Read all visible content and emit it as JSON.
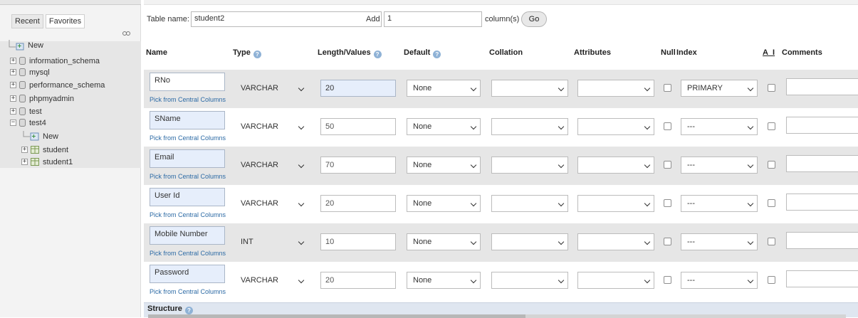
{
  "sidebar": {
    "tabs": [
      "Recent",
      "Favorites"
    ],
    "tree": [
      {
        "label": "New",
        "kind": "new"
      },
      {
        "label": "information_schema",
        "kind": "db"
      },
      {
        "label": "mysql",
        "kind": "db"
      },
      {
        "label": "performance_schema",
        "kind": "db"
      },
      {
        "label": "phpmyadmin",
        "kind": "db"
      },
      {
        "label": "test",
        "kind": "db"
      },
      {
        "label": "test4",
        "kind": "db-open"
      },
      {
        "label": "New",
        "kind": "new-child"
      },
      {
        "label": "student",
        "kind": "table"
      },
      {
        "label": "student1",
        "kind": "table"
      }
    ]
  },
  "form": {
    "table_name_label": "Table name:",
    "table_name_value": "student2",
    "add_label": "Add",
    "add_value": "1",
    "columns_label": "column(s)",
    "go_label": "Go"
  },
  "headers": {
    "name": "Name",
    "type": "Type",
    "length": "Length/Values",
    "default": "Default",
    "collation": "Collation",
    "attributes": "Attributes",
    "null": "Null",
    "index": "Index",
    "ai": "A_I",
    "comments": "Comments"
  },
  "pick_label": "Pick from Central Columns",
  "rows": [
    {
      "name": "RNo",
      "type": "VARCHAR",
      "length": "20",
      "default": "None",
      "index": "PRIMARY"
    },
    {
      "name": "SName",
      "type": "VARCHAR",
      "length": "50",
      "default": "None",
      "index": "---"
    },
    {
      "name": "Email",
      "type": "VARCHAR",
      "length": "70",
      "default": "None",
      "index": "---"
    },
    {
      "name": "User Id",
      "type": "VARCHAR",
      "length": "20",
      "default": "None",
      "index": "---"
    },
    {
      "name": "Mobile Number",
      "type": "INT",
      "length": "10",
      "default": "None",
      "index": "---"
    },
    {
      "name": "Password",
      "type": "VARCHAR",
      "length": "20",
      "default": "None",
      "index": "---"
    }
  ],
  "footer": {
    "structure_label": "Structure"
  },
  "colors": {
    "row_shade": "#e6e6e6",
    "input_highlight": "#e6eefb",
    "link": "#2c6aa5"
  }
}
